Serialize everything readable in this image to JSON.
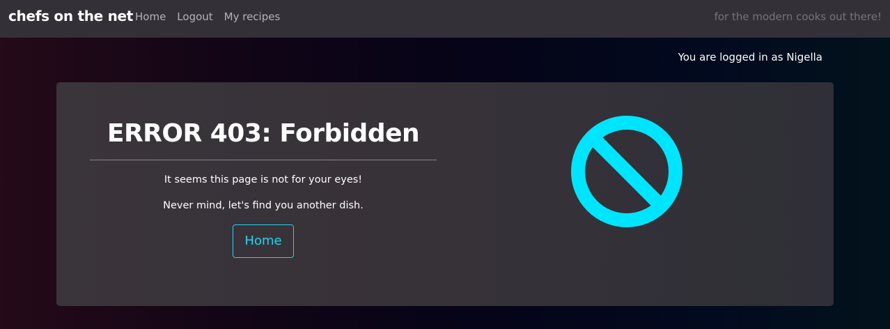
{
  "navbar": {
    "brand": "chefs on the net",
    "links": [
      "Home",
      "Logout",
      "My recipes"
    ],
    "tagline": "for the modern cooks out there!"
  },
  "login_status": "You are logged in as Nigella",
  "error": {
    "title": "ERROR 403: Forbidden",
    "message1": "It seems this page is not for your eyes!",
    "message2": "Never mind, let's find you another dish.",
    "button_label": "Home",
    "icon": "forbidden-icon",
    "accent_color": "#00e5ff"
  }
}
